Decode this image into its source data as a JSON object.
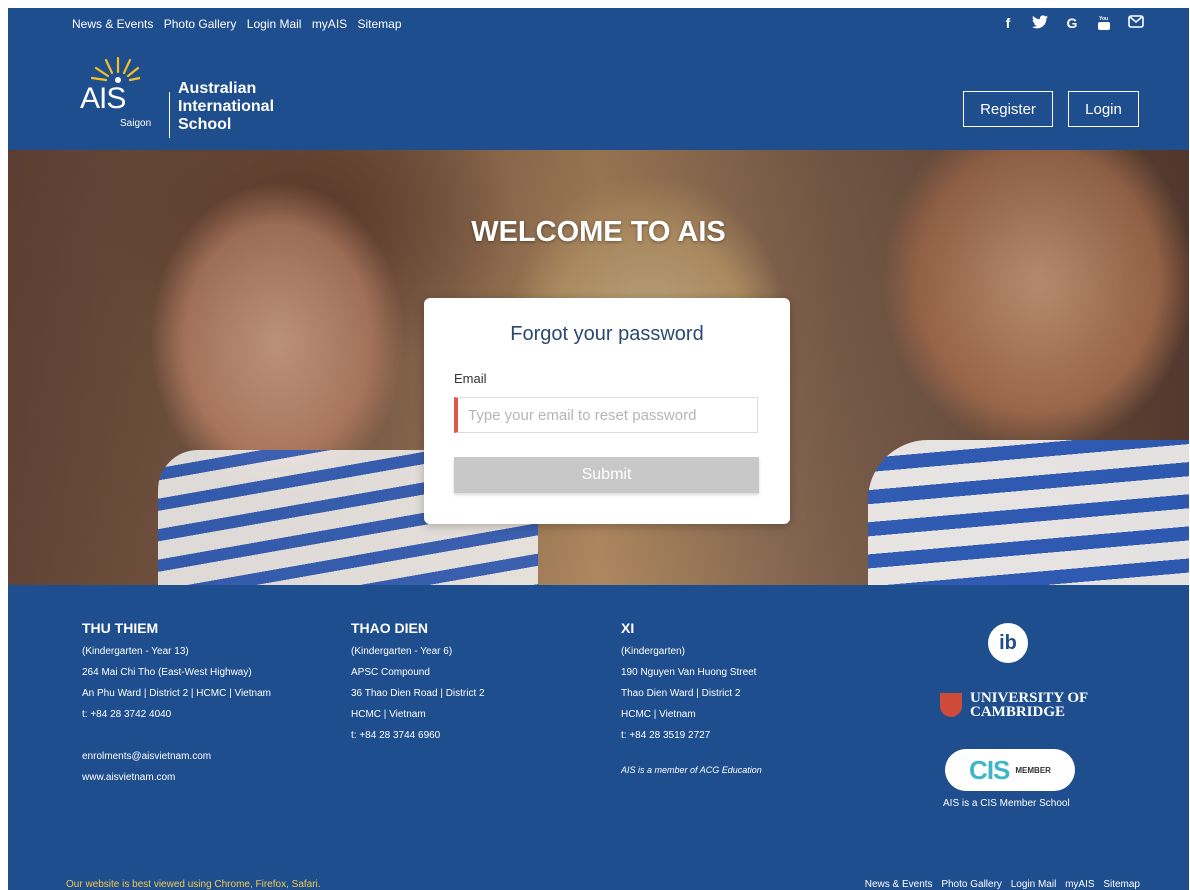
{
  "top_nav": {
    "links": [
      "News & Events",
      "Photo Gallery",
      "Login Mail",
      "myAIS",
      "Sitemap"
    ],
    "social_icons": [
      {
        "name": "facebook-icon",
        "glyph": "f"
      },
      {
        "name": "twitter-icon",
        "glyph": "🐦"
      },
      {
        "name": "google-icon",
        "glyph": "G"
      },
      {
        "name": "youtube-icon",
        "glyph": "▶"
      },
      {
        "name": "email-icon",
        "glyph": "✉"
      }
    ]
  },
  "header": {
    "logo_mark": "AIS",
    "logo_sub": "Saigon",
    "school_name": [
      "Australian",
      "International",
      "School"
    ],
    "register_label": "Register",
    "login_label": "Login"
  },
  "hero": {
    "welcome": "WELCOME TO AIS"
  },
  "form": {
    "title": "Forgot your password",
    "email_label": "Email",
    "email_placeholder": "Type your email to reset password",
    "email_value": "",
    "submit_label": "Submit"
  },
  "footer": {
    "campuses": [
      {
        "name": "THU THIEM",
        "lines": [
          "(Kindergarten - Year 13)",
          "264 Mai Chi Tho (East-West Highway)",
          "An Phu Ward | District 2 | HCMC | Vietnam",
          "t: +84 28 3742 4040",
          "",
          "enrolments@aisvietnam.com",
          "www.aisvietnam.com"
        ]
      },
      {
        "name": "THAO DIEN",
        "lines": [
          "(Kindergarten - Year 6)",
          "APSC Compound",
          "36 Thao Dien Road | District 2",
          "HCMC | Vietnam",
          "t: +84 28 3744 6960"
        ]
      },
      {
        "name": "XI",
        "lines": [
          "(Kindergarten)",
          "190 Nguyen Van Huong Street",
          "Thao Dien Ward | District 2",
          "HCMC | Vietnam",
          "t: +84 28 3519 2727"
        ],
        "note": "AIS is a member of ACG Education"
      }
    ],
    "ib_label": "ib",
    "cambridge": [
      "UNIVERSITY OF",
      "CAMBRIDGE"
    ],
    "cis_big": "CIS",
    "cis_small": "MEMBER",
    "cis_caption": "AIS is a CIS Member School"
  },
  "bottom": {
    "notice": "Our website is best viewed using Chrome, Firefox, Safari.",
    "links": [
      "News & Events",
      "Photo Gallery",
      "Login Mail",
      "myAIS",
      "Sitemap"
    ]
  },
  "colors": {
    "brand_blue": "#1f4e8f",
    "input_accent": "#e05a4a",
    "notice_yellow": "#f2c94c"
  }
}
